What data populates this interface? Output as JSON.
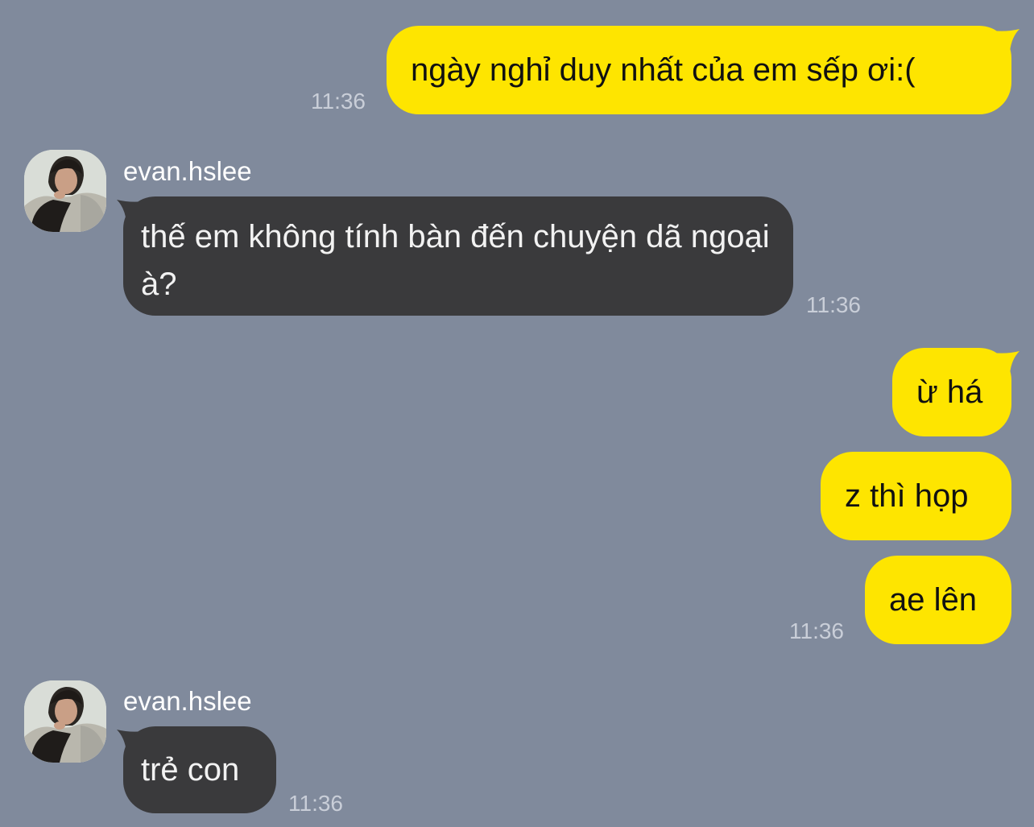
{
  "messages": [
    {
      "text": "ngày nghỉ duy nhất của em sếp ơi:(",
      "time": "11:36"
    },
    {
      "sender": "evan.hslee",
      "text": "thế em không tính bàn đến chuyện dã ngoại à?",
      "time": "11:36"
    },
    {
      "text": "ừ há"
    },
    {
      "text": "z thì họp"
    },
    {
      "text": "ae lên",
      "time": "11:36"
    },
    {
      "sender": "evan.hslee",
      "text": "trẻ con",
      "time": "11:36"
    }
  ],
  "colors": {
    "background": "#808a9c",
    "outgoing_bubble": "#fee500",
    "incoming_bubble": "#3a3a3c"
  },
  "icons": {
    "avatar": "contact-avatar-photo"
  }
}
